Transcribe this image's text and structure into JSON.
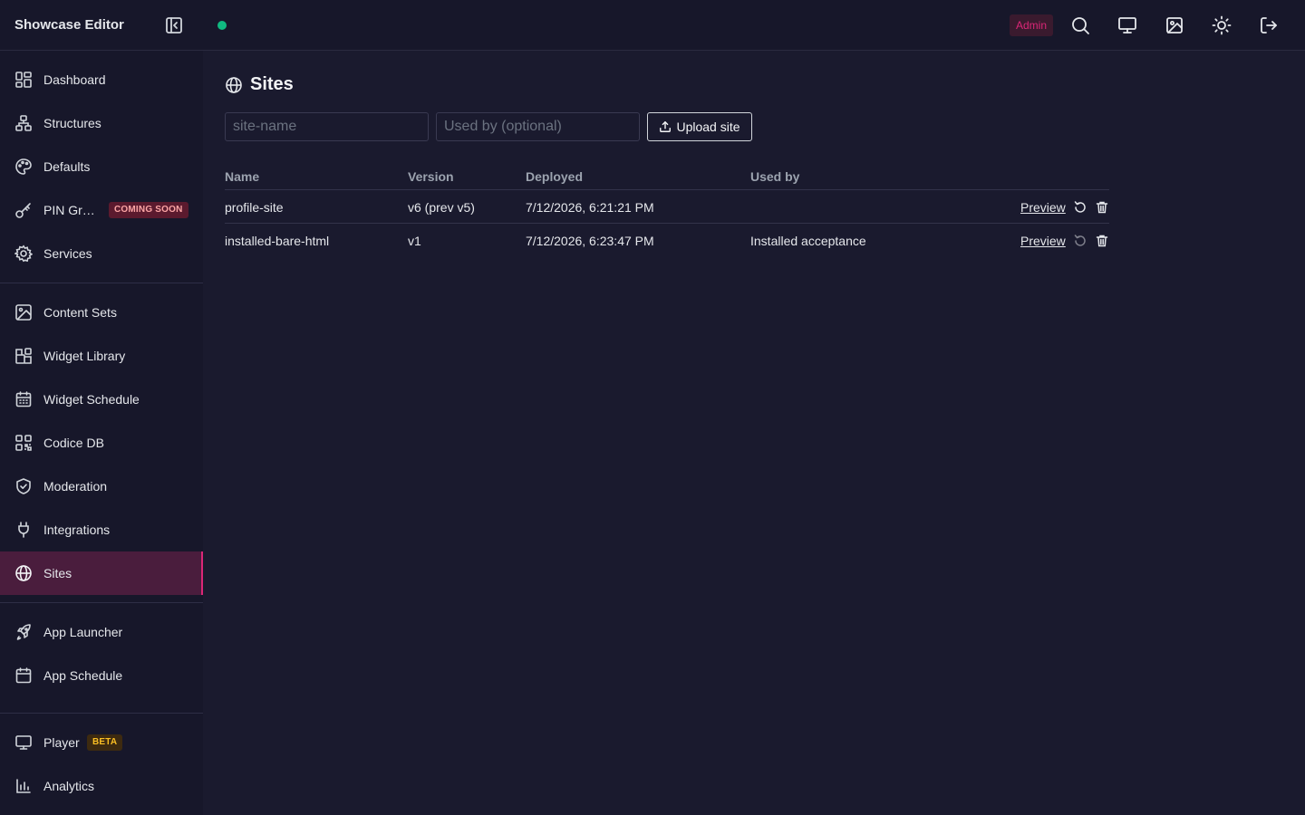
{
  "app": {
    "title": "Showcase Editor"
  },
  "topbar": {
    "badge": "Admin",
    "status_color": "#10b981",
    "accent": "#db2777"
  },
  "sidebar": {
    "items": [
      {
        "label": "Dashboard",
        "icon": "dashboard-icon"
      },
      {
        "label": "Structures",
        "icon": "structures-icon"
      },
      {
        "label": "Defaults",
        "icon": "palette-icon"
      },
      {
        "label": "PIN Gr…",
        "icon": "key-icon",
        "pill": "COMING SOON"
      },
      {
        "label": "Services",
        "icon": "gear-icon"
      },
      {
        "label": "Content Sets",
        "icon": "image-icon"
      },
      {
        "label": "Widget Library",
        "icon": "widgets-icon"
      },
      {
        "label": "Widget Schedule",
        "icon": "calendar-icon"
      },
      {
        "label": "Codice DB",
        "icon": "qr-icon"
      },
      {
        "label": "Moderation",
        "icon": "shield-icon"
      },
      {
        "label": "Integrations",
        "icon": "plug-icon"
      },
      {
        "label": "Sites",
        "icon": "globe-icon",
        "active": true
      },
      {
        "label": "App Launcher",
        "icon": "rocket-icon"
      },
      {
        "label": "App Schedule",
        "icon": "calendar-icon"
      },
      {
        "label": "Player",
        "icon": "monitor-icon",
        "pill": "BETA"
      },
      {
        "label": "Analytics",
        "icon": "chart-icon"
      }
    ]
  },
  "main": {
    "title": "Sites",
    "form": {
      "name_placeholder": "site-name",
      "used_by_placeholder": "Used by (optional)",
      "upload_label": "Upload site"
    },
    "table": {
      "headers": [
        "Name",
        "Version",
        "Deployed",
        "Used by"
      ],
      "rows": [
        {
          "name": "profile-site",
          "version": "v6 (prev v5)",
          "deployed": "7/12/2026, 6:21:21 PM",
          "used_by": "",
          "action": "Preview"
        },
        {
          "name": "installed-bare-html",
          "version": "v1",
          "deployed": "7/12/2026, 6:23:47 PM",
          "used_by": "Installed acceptance",
          "action": "Preview"
        }
      ]
    }
  }
}
